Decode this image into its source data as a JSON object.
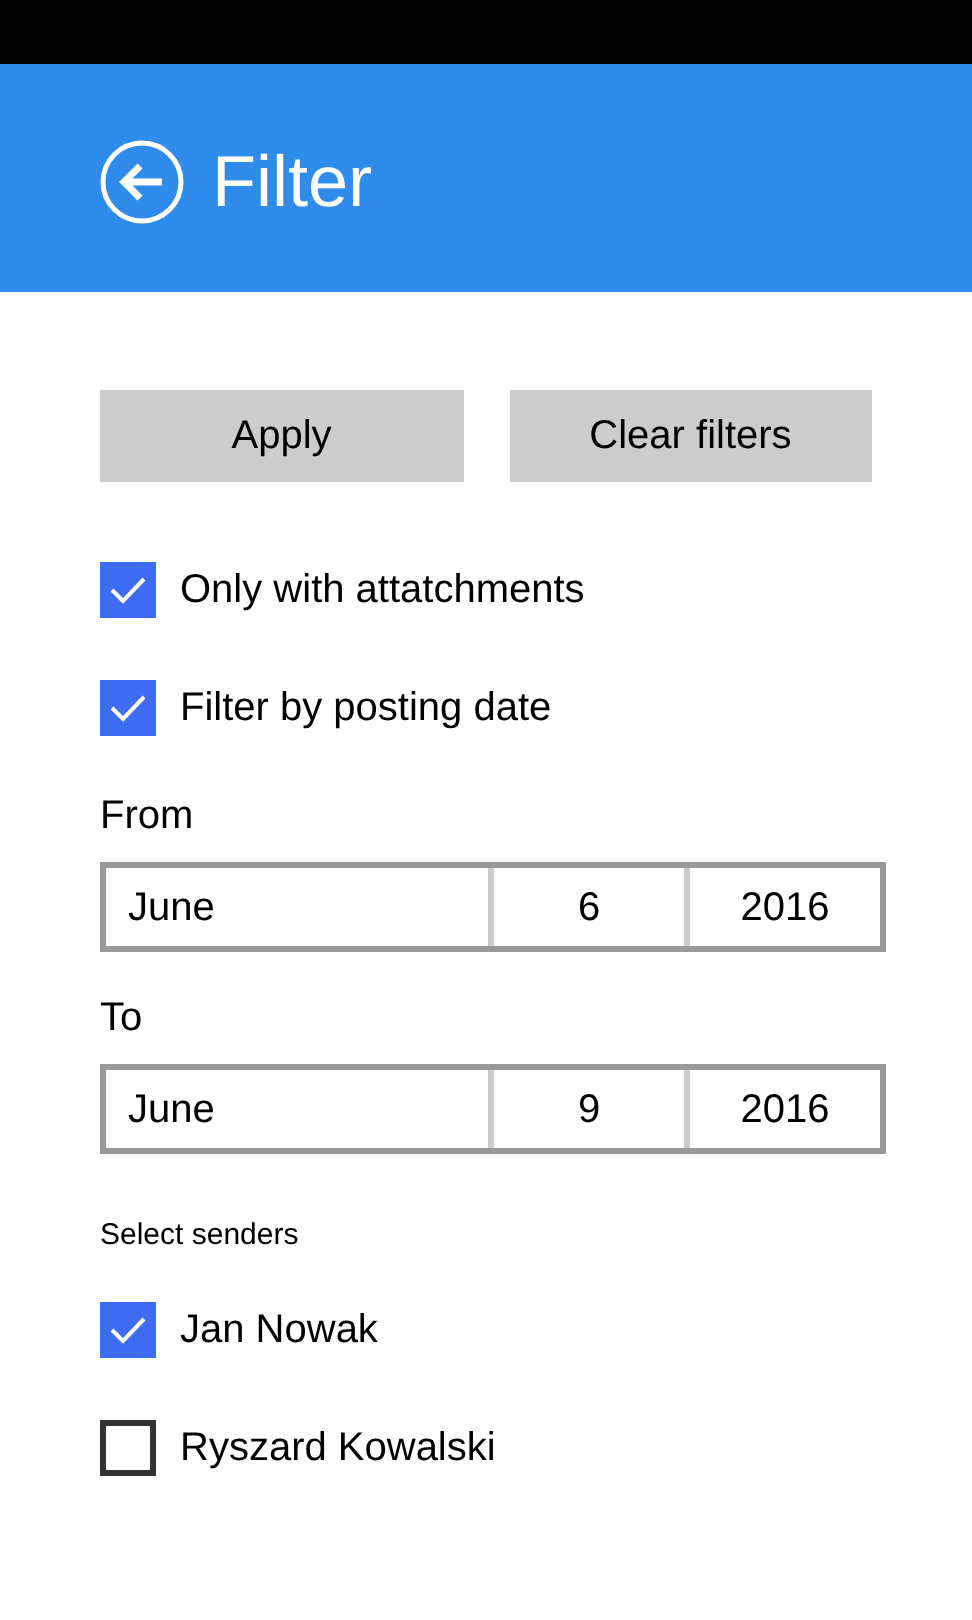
{
  "header": {
    "title": "Filter"
  },
  "buttons": [
    "Apply",
    "Clear filters"
  ],
  "options": [
    {
      "label": "Only with attatchments",
      "checked": true
    },
    {
      "label": "Filter by posting date",
      "checked": true
    }
  ],
  "date_ranges": [
    {
      "label": "From",
      "month": "June",
      "day": "6",
      "year": "2016"
    },
    {
      "label": "To",
      "month": "June",
      "day": "9",
      "year": "2016"
    }
  ],
  "senders": {
    "heading": "Select senders",
    "items": [
      {
        "label": "Jan Nowak",
        "checked": true
      },
      {
        "label": "Ryszard Kowalski",
        "checked": false
      }
    ]
  }
}
